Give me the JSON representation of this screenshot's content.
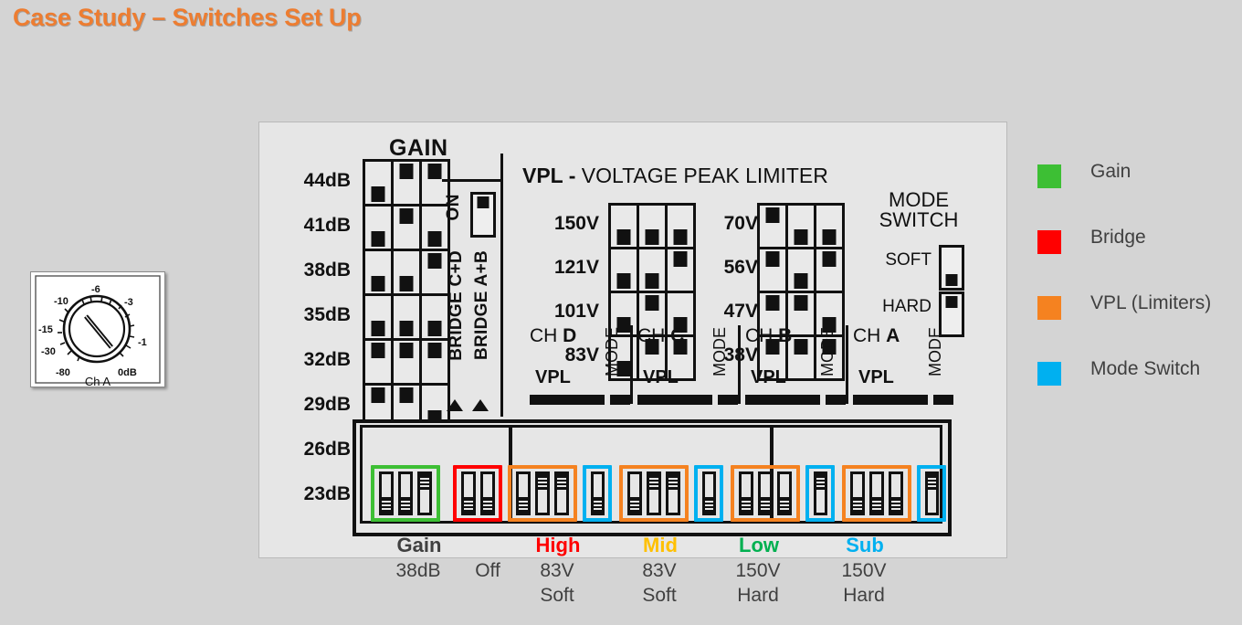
{
  "title": "Case Study – Switches Set Up",
  "colors": {
    "title": "#ED7D31",
    "gain": "#3DBF34",
    "bridge": "#FF0000",
    "vpl": "#F58220",
    "mode": "#00B0F0",
    "high": "#FF0000",
    "mid": "#FFC000",
    "low": "#00B050",
    "sub": "#00B0F0",
    "gainlabel": "#404040"
  },
  "knob": {
    "channel": "Ch A",
    "ticks": [
      "-6",
      "-10",
      "-3",
      "-15",
      "-1",
      "-30",
      "-80",
      "0dB"
    ]
  },
  "panel": {
    "gain": {
      "title": "GAIN",
      "rows": [
        {
          "label": "44dB",
          "sw": [
            "down",
            "up",
            "up"
          ]
        },
        {
          "label": "41dB",
          "sw": [
            "down",
            "up",
            "down"
          ]
        },
        {
          "label": "38dB",
          "sw": [
            "down",
            "down",
            "up"
          ]
        },
        {
          "label": "35dB",
          "sw": [
            "down",
            "down",
            "down"
          ]
        },
        {
          "label": "32dB",
          "sw": [
            "up",
            "up",
            "up"
          ]
        },
        {
          "label": "29dB",
          "sw": [
            "up",
            "up",
            "down"
          ]
        },
        {
          "label": "26dB",
          "sw": [
            "up",
            "down",
            "up"
          ]
        },
        {
          "label": "23dB",
          "sw": [
            "up",
            "down",
            "down"
          ]
        }
      ],
      "on_label": "ON",
      "on_switch": "up",
      "bridge_cd": "BRIDGE C+D",
      "bridge_ab": "BRIDGE A+B"
    },
    "vpl": {
      "heading_bold": "VPL -",
      "heading_rest": " VOLTAGE PEAK LIMITER",
      "left_rows": [
        {
          "label": "150V",
          "sw": [
            "down",
            "down",
            "down"
          ]
        },
        {
          "label": "121V",
          "sw": [
            "down",
            "down",
            "up"
          ]
        },
        {
          "label": "101V",
          "sw": [
            "down",
            "up",
            "down"
          ]
        },
        {
          "label": "83V",
          "sw": [
            "down",
            "up",
            "up"
          ]
        }
      ],
      "right_rows": [
        {
          "label": "70V",
          "sw": [
            "up",
            "down",
            "down"
          ]
        },
        {
          "label": "56V",
          "sw": [
            "up",
            "down",
            "up"
          ]
        },
        {
          "label": "47V",
          "sw": [
            "up",
            "up",
            "down"
          ]
        },
        {
          "label": "38V",
          "sw": [
            "up",
            "up",
            "up"
          ]
        }
      ]
    },
    "mode_switch": {
      "title_line1": "MODE",
      "title_line2": "SWITCH",
      "soft_label": "SOFT",
      "soft_pos": "down",
      "hard_label": "HARD",
      "hard_pos": "up"
    },
    "channels": [
      {
        "prefix": "CH ",
        "name": "D",
        "vpl": "VPL",
        "mode": "MODE"
      },
      {
        "prefix": "CH ",
        "name": "C",
        "vpl": "VPL",
        "mode": "MODE"
      },
      {
        "prefix": "CH ",
        "name": "B",
        "vpl": "VPL",
        "mode": "MODE"
      },
      {
        "prefix": "CH ",
        "name": "A",
        "vpl": "VPL",
        "mode": "MODE"
      }
    ],
    "dip_groups": [
      {
        "name": "gain",
        "color": "#3DBF34",
        "switches": [
          "down",
          "down",
          "up"
        ]
      },
      {
        "name": "bridge",
        "color": "#FF0000",
        "switches": [
          "down",
          "down"
        ]
      },
      {
        "name": "vpl-chd",
        "color": "#F58220",
        "switches": [
          "down",
          "up",
          "up"
        ]
      },
      {
        "name": "mode-chd",
        "color": "#00B0F0",
        "switches": [
          "down"
        ]
      },
      {
        "name": "vpl-chc",
        "color": "#F58220",
        "switches": [
          "down",
          "up",
          "up"
        ]
      },
      {
        "name": "mode-chc",
        "color": "#00B0F0",
        "switches": [
          "down"
        ]
      },
      {
        "name": "vpl-chb",
        "color": "#F58220",
        "switches": [
          "down",
          "down",
          "down"
        ]
      },
      {
        "name": "mode-chb",
        "color": "#00B0F0",
        "switches": [
          "up"
        ]
      },
      {
        "name": "vpl-cha",
        "color": "#F58220",
        "switches": [
          "down",
          "down",
          "down"
        ]
      },
      {
        "name": "mode-cha",
        "color": "#00B0F0",
        "switches": [
          "up"
        ]
      }
    ],
    "bottom_labels": [
      {
        "text": "Gain",
        "color": "#404040"
      },
      {
        "text": "High",
        "color": "#FF0000"
      },
      {
        "text": "Mid",
        "color": "#FFC000"
      },
      {
        "text": "Low",
        "color": "#00B050"
      },
      {
        "text": "Sub",
        "color": "#00B0F0"
      }
    ]
  },
  "summary": [
    {
      "line1": "38dB",
      "line2": ""
    },
    {
      "line1": "Off",
      "line2": ""
    },
    {
      "line1": "83V",
      "line2": "Soft"
    },
    {
      "line1": "83V",
      "line2": "Soft"
    },
    {
      "line1": "150V",
      "line2": "Hard"
    },
    {
      "line1": "150V",
      "line2": "Hard"
    }
  ],
  "legend": [
    {
      "label": "Gain",
      "color": "#3DBF34"
    },
    {
      "label": "Bridge",
      "color": "#FF0000"
    },
    {
      "label": "VPL (Limiters)",
      "color": "#F58220"
    },
    {
      "label": "Mode Switch",
      "color": "#00B0F0"
    }
  ]
}
